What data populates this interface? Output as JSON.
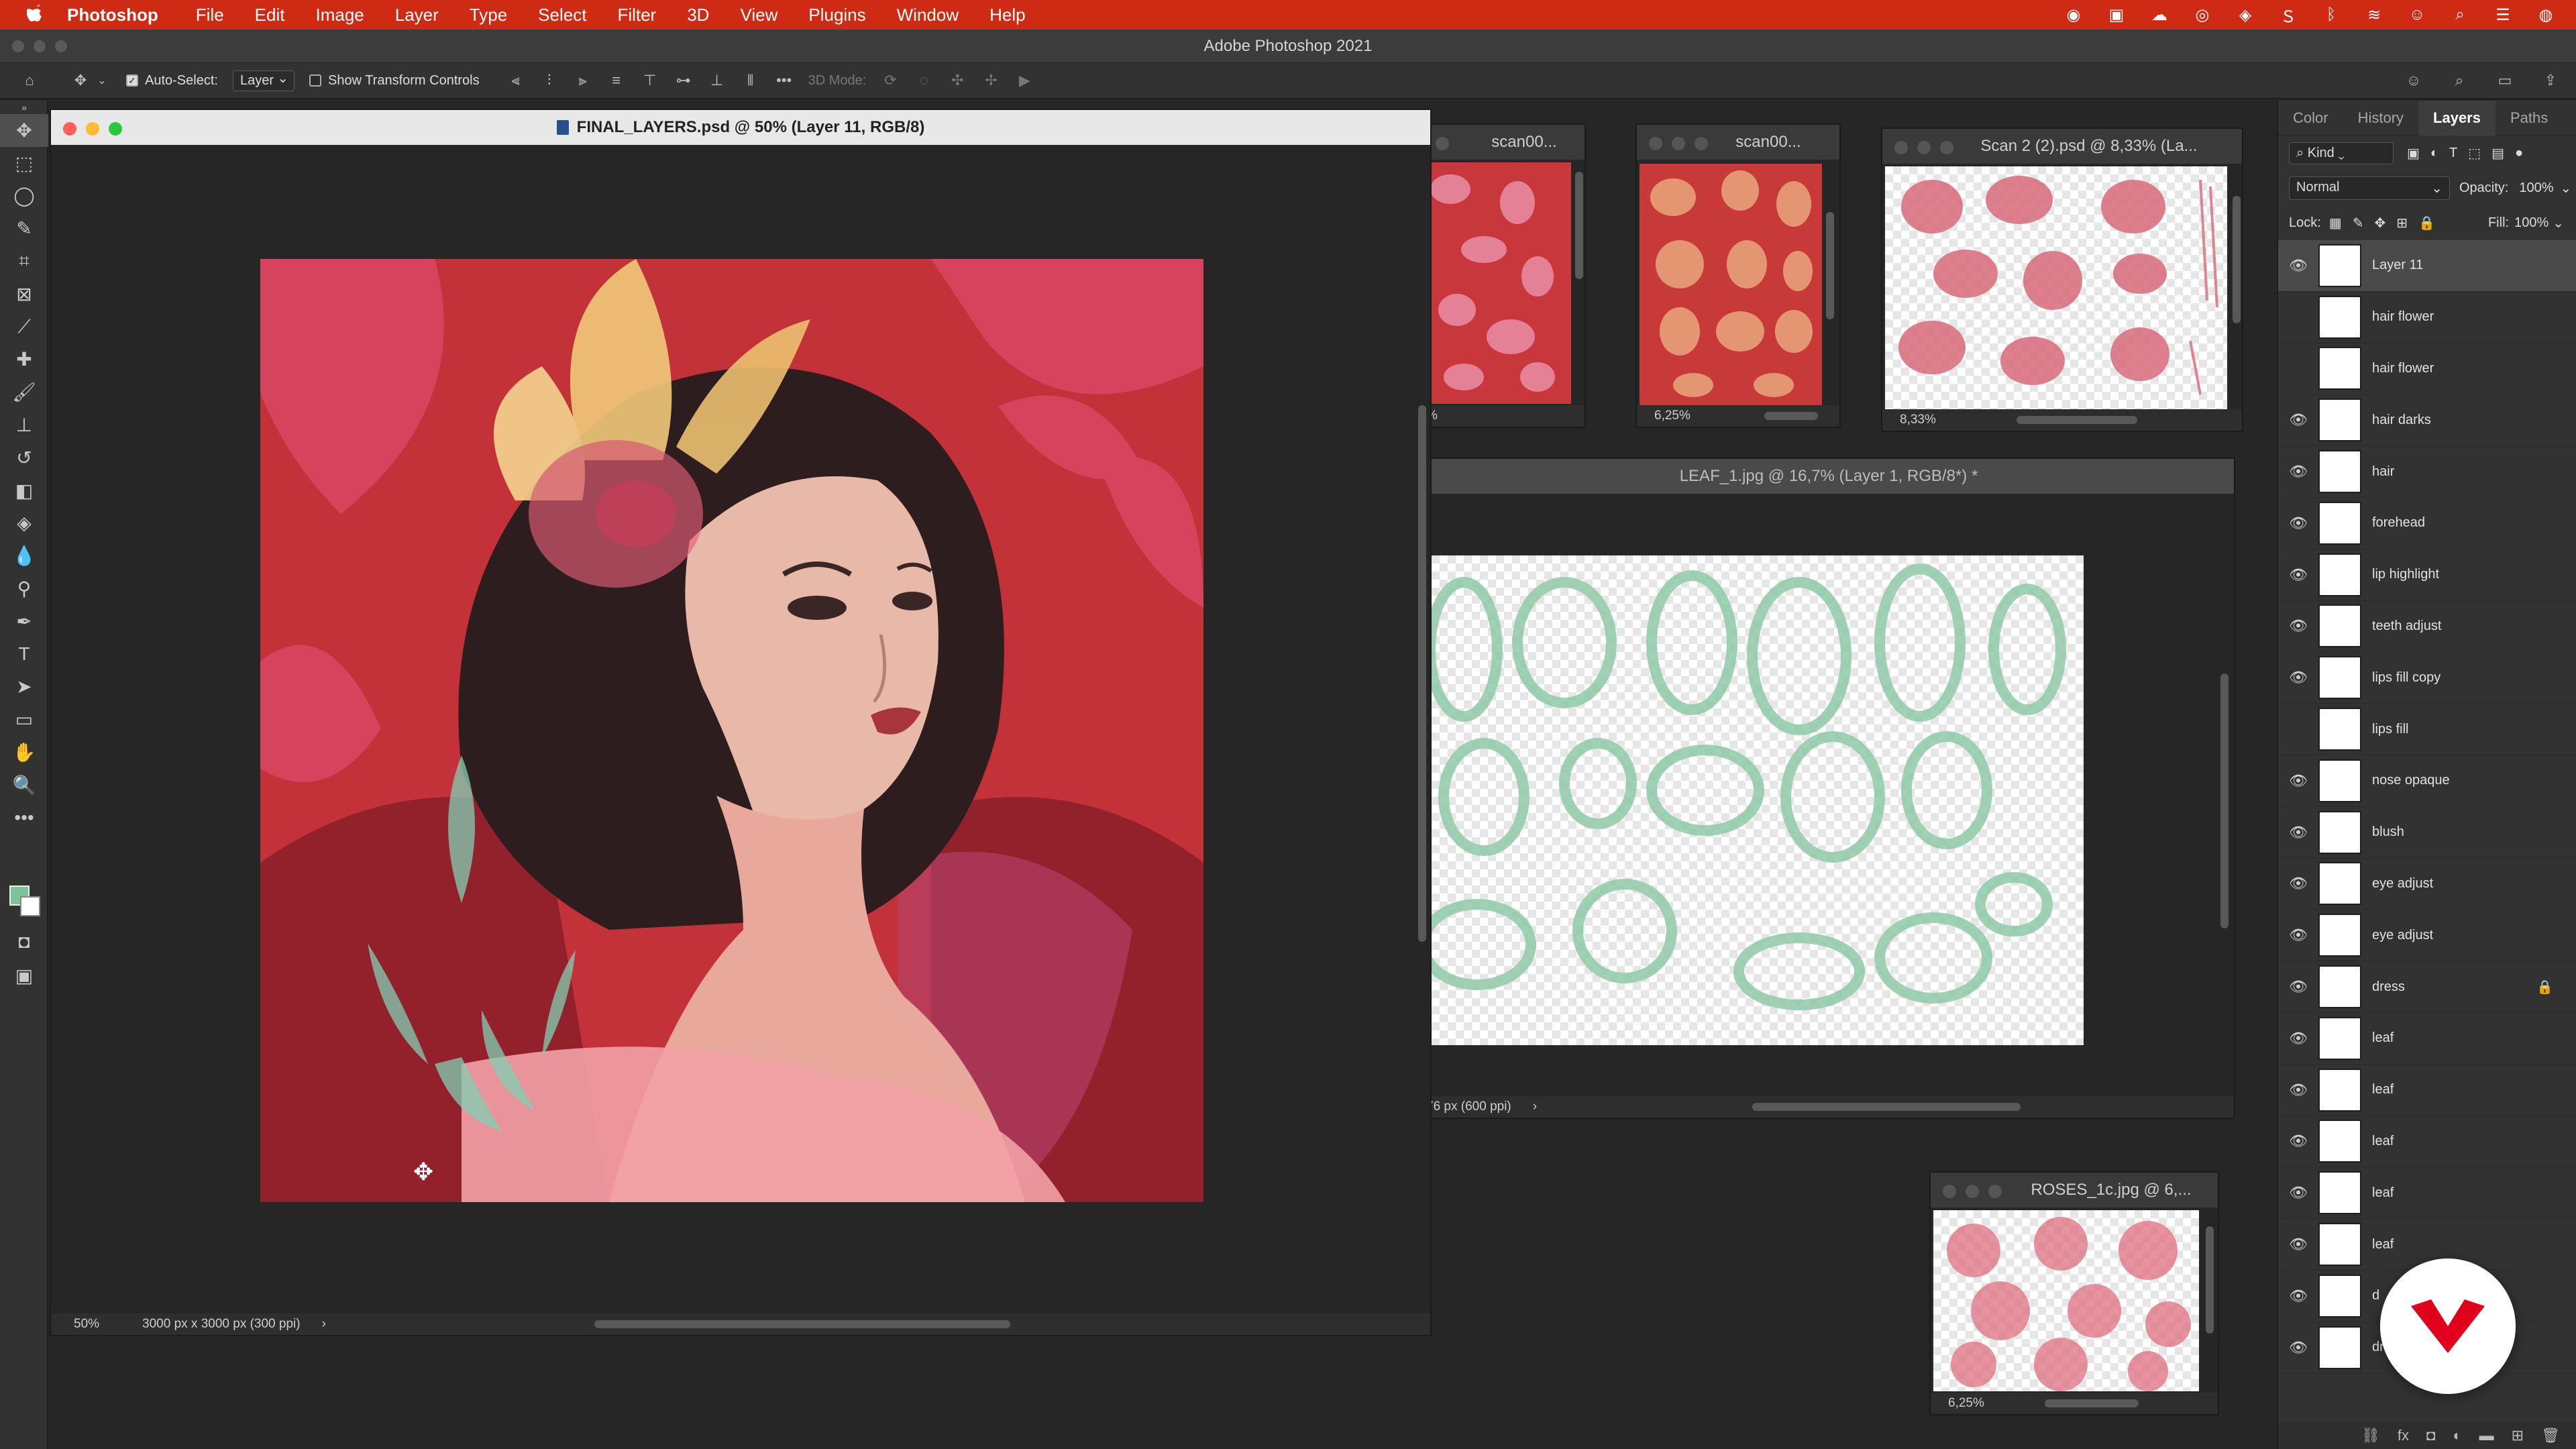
{
  "menubar": {
    "app": "Photoshop",
    "items": [
      "File",
      "Edit",
      "Image",
      "Layer",
      "Type",
      "Select",
      "Filter",
      "3D",
      "View",
      "Plugins",
      "Window",
      "Help"
    ]
  },
  "app_title": "Adobe Photoshop 2021",
  "options_bar": {
    "auto_select_label": "Auto-Select:",
    "auto_select_checked": true,
    "auto_select_value": "Layer",
    "transform_label": "Show Transform Controls",
    "mode_3d_label": "3D Mode:"
  },
  "main_doc": {
    "title": "FINAL_LAYERS.psd @ 50% (Layer 11, RGB/8)",
    "zoom": "50%",
    "dimensions": "3000 px x 3000 px (300 ppi)"
  },
  "docs": {
    "scan1": {
      "title": "scan00...",
      "zoom": "%"
    },
    "scan2": {
      "title": "scan00...",
      "zoom": "6,25%"
    },
    "scan3": {
      "title": "Scan 2 (2).psd @ 8,33% (La...",
      "zoom": "8,33%"
    },
    "leaf": {
      "title": "LEAF_1.jpg @ 16,7% (Layer 1, RGB/8*) *",
      "status": "76 px (600 ppi)"
    },
    "roses": {
      "title": "ROSES_1c.jpg @ 6,...",
      "zoom": "6,25%"
    }
  },
  "panel": {
    "tabs": [
      "Color",
      "History",
      "Layers",
      "Paths"
    ],
    "active_tab": "Layers",
    "filter": "Kind",
    "blend_mode": "Normal",
    "opacity_label": "Opacity:",
    "opacity_value": "100%",
    "lock_label": "Lock:",
    "fill_label": "Fill:",
    "fill_value": "100%",
    "layers": [
      {
        "name": "Layer 11",
        "visible": true,
        "selected": true
      },
      {
        "name": "hair flower",
        "visible": false
      },
      {
        "name": "hair flower",
        "visible": false
      },
      {
        "name": "hair darks",
        "visible": true
      },
      {
        "name": "hair",
        "visible": true
      },
      {
        "name": "forehead",
        "visible": true
      },
      {
        "name": "lip highlight",
        "visible": true
      },
      {
        "name": "teeth adjust",
        "visible": true
      },
      {
        "name": "lips fill copy",
        "visible": true
      },
      {
        "name": "lips fill",
        "visible": false
      },
      {
        "name": "nose opaque",
        "visible": true
      },
      {
        "name": "blush",
        "visible": true
      },
      {
        "name": "eye adjust",
        "visible": true
      },
      {
        "name": "eye adjust",
        "visible": true
      },
      {
        "name": "dress",
        "visible": true,
        "locked": true
      },
      {
        "name": "leaf",
        "visible": true
      },
      {
        "name": "leaf",
        "visible": true
      },
      {
        "name": "leaf",
        "visible": true
      },
      {
        "name": "leaf",
        "visible": true
      },
      {
        "name": "leaf",
        "visible": true
      },
      {
        "name": "d",
        "visible": true
      },
      {
        "name": "dres",
        "visible": true
      }
    ]
  },
  "colors": {
    "menubar": "#cf2a14",
    "canvas_red": "#c23238",
    "foreground": "#7cc39c",
    "leaf_green": "#8fc9a8",
    "rose_pink": "#d86a7a"
  }
}
